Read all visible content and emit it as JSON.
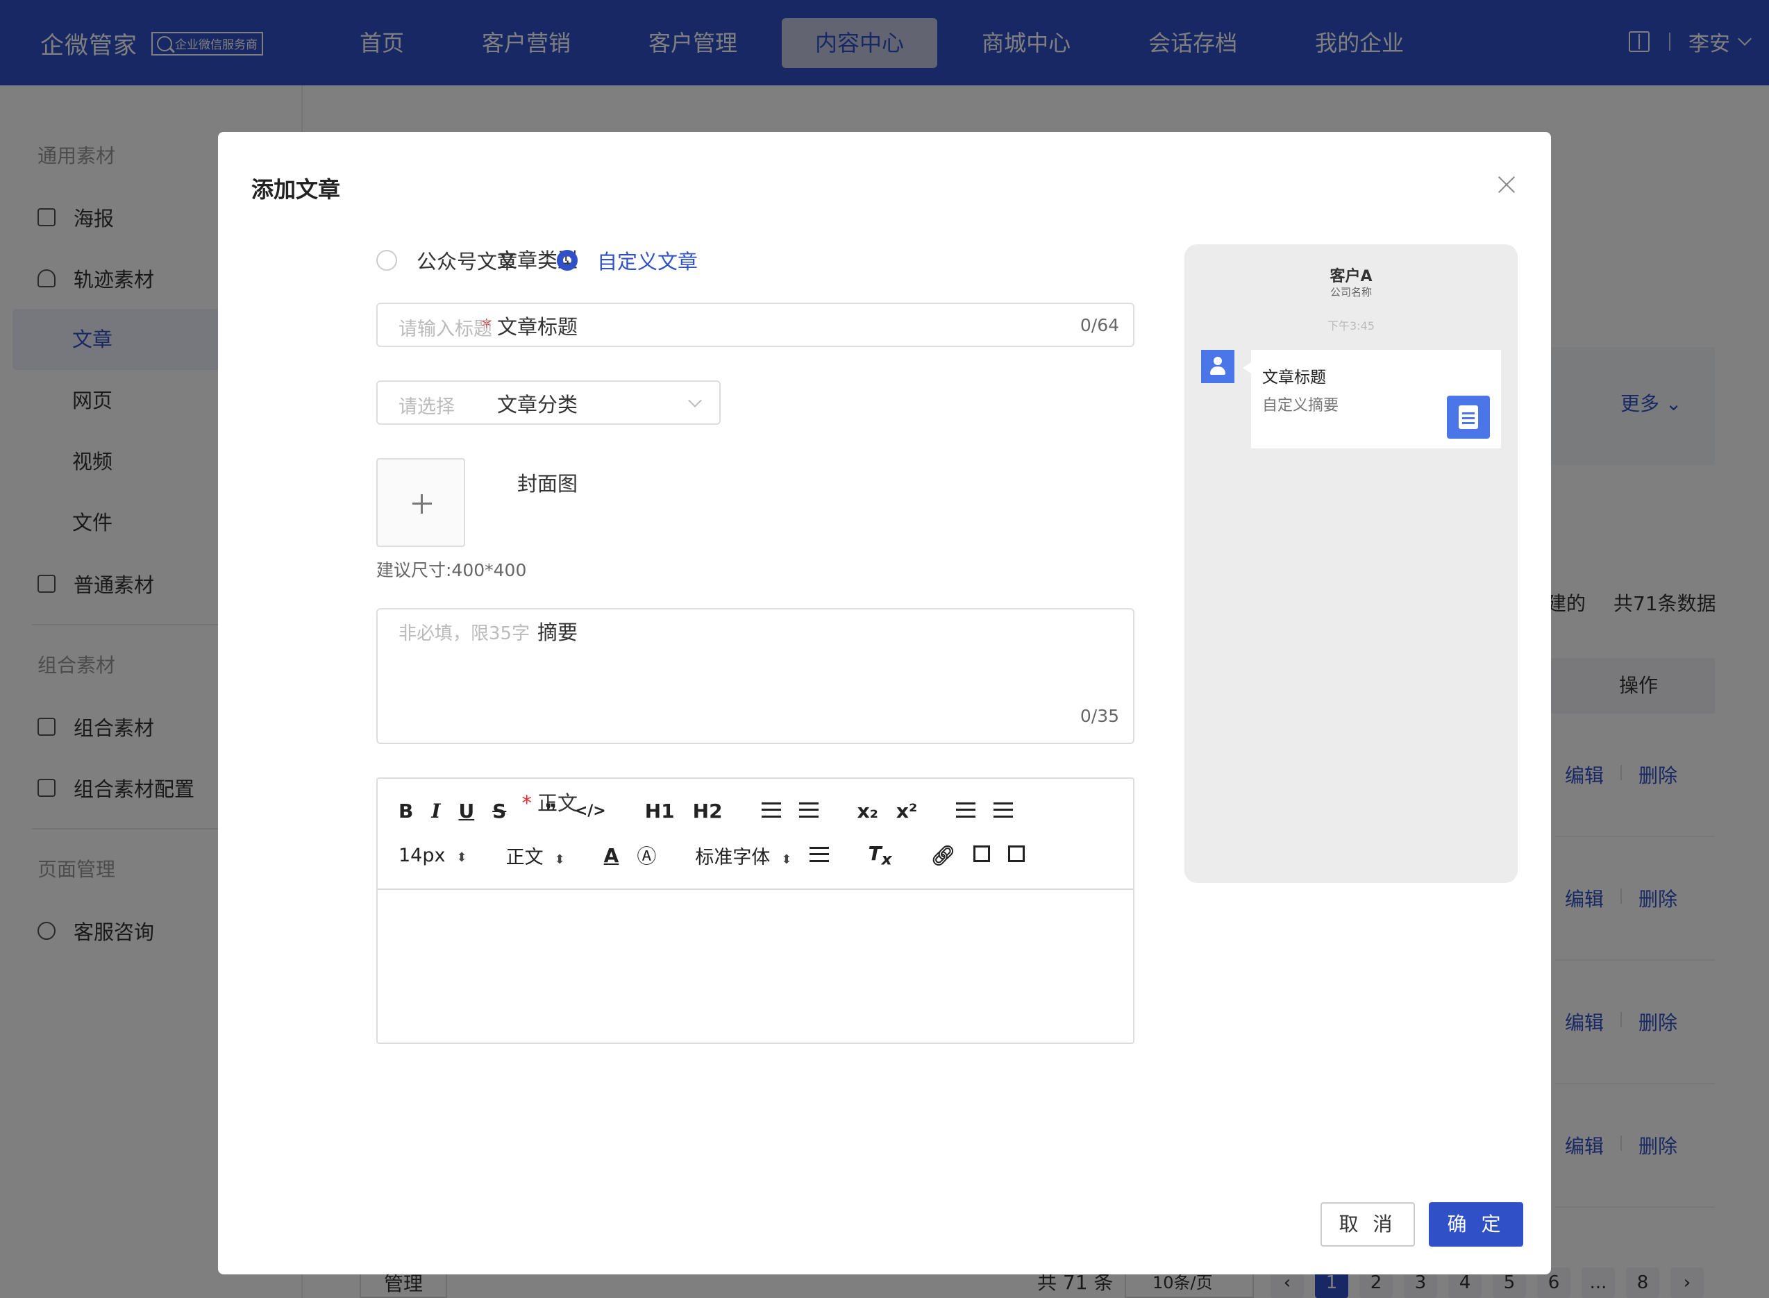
{
  "brand": {
    "name": "企微管家",
    "badge": "企业微信服务商"
  },
  "nav": [
    "首页",
    "客户营销",
    "客户管理",
    "内容中心",
    "商城中心",
    "会话存档",
    "我的企业"
  ],
  "nav_active": "内容中心",
  "user": {
    "name": "李安"
  },
  "sidebar": {
    "group1": "通用素材",
    "poster": "海报",
    "track": "轨迹素材",
    "article": "文章",
    "webpage": "网页",
    "video": "视频",
    "file": "文件",
    "normal": "普通素材",
    "group2": "组合素材",
    "combo": "组合素材",
    "combo_config": "组合素材配置",
    "group3": "页面管理",
    "service": "客服咨询"
  },
  "background": {
    "more": "更多",
    "created_suffix": "建的",
    "total_data": "共71条数据",
    "col_action": "操作",
    "edit": "编辑",
    "delete": "删除",
    "manage": "管理",
    "total": "共 71 条",
    "page_size": "10条/页",
    "pages": [
      "1",
      "2",
      "3",
      "4",
      "5",
      "6",
      "...",
      "8"
    ],
    "current_page": "1"
  },
  "modal": {
    "title": "添加文章",
    "type_label": "文章类型",
    "type_opt1": "公众号文章",
    "type_opt2": "自定义文章",
    "type_selected": "自定义文章",
    "title_label": "文章标题",
    "title_placeholder": "请输入标题",
    "title_count": "0/64",
    "category_label": "文章分类",
    "category_placeholder": "请选择",
    "cover_label": "封面图",
    "cover_hint": "建议尺寸:400*400",
    "summary_label": "摘要",
    "summary_placeholder": "非必填，限35字",
    "summary_count": "0/35",
    "body_label": "正文",
    "toolbar": {
      "font_size": "14px",
      "heading": "正文",
      "font_family": "标准字体",
      "h1": "H1",
      "h2": "H2"
    },
    "cancel": "取 消",
    "confirm": "确 定"
  },
  "preview": {
    "customer": "客户A",
    "company": "公司名称",
    "time": "下午3:45",
    "card_title": "文章标题",
    "card_summary": "自定义摘要"
  },
  "colors": {
    "primary": "#3050c8",
    "required": "#e03030"
  }
}
